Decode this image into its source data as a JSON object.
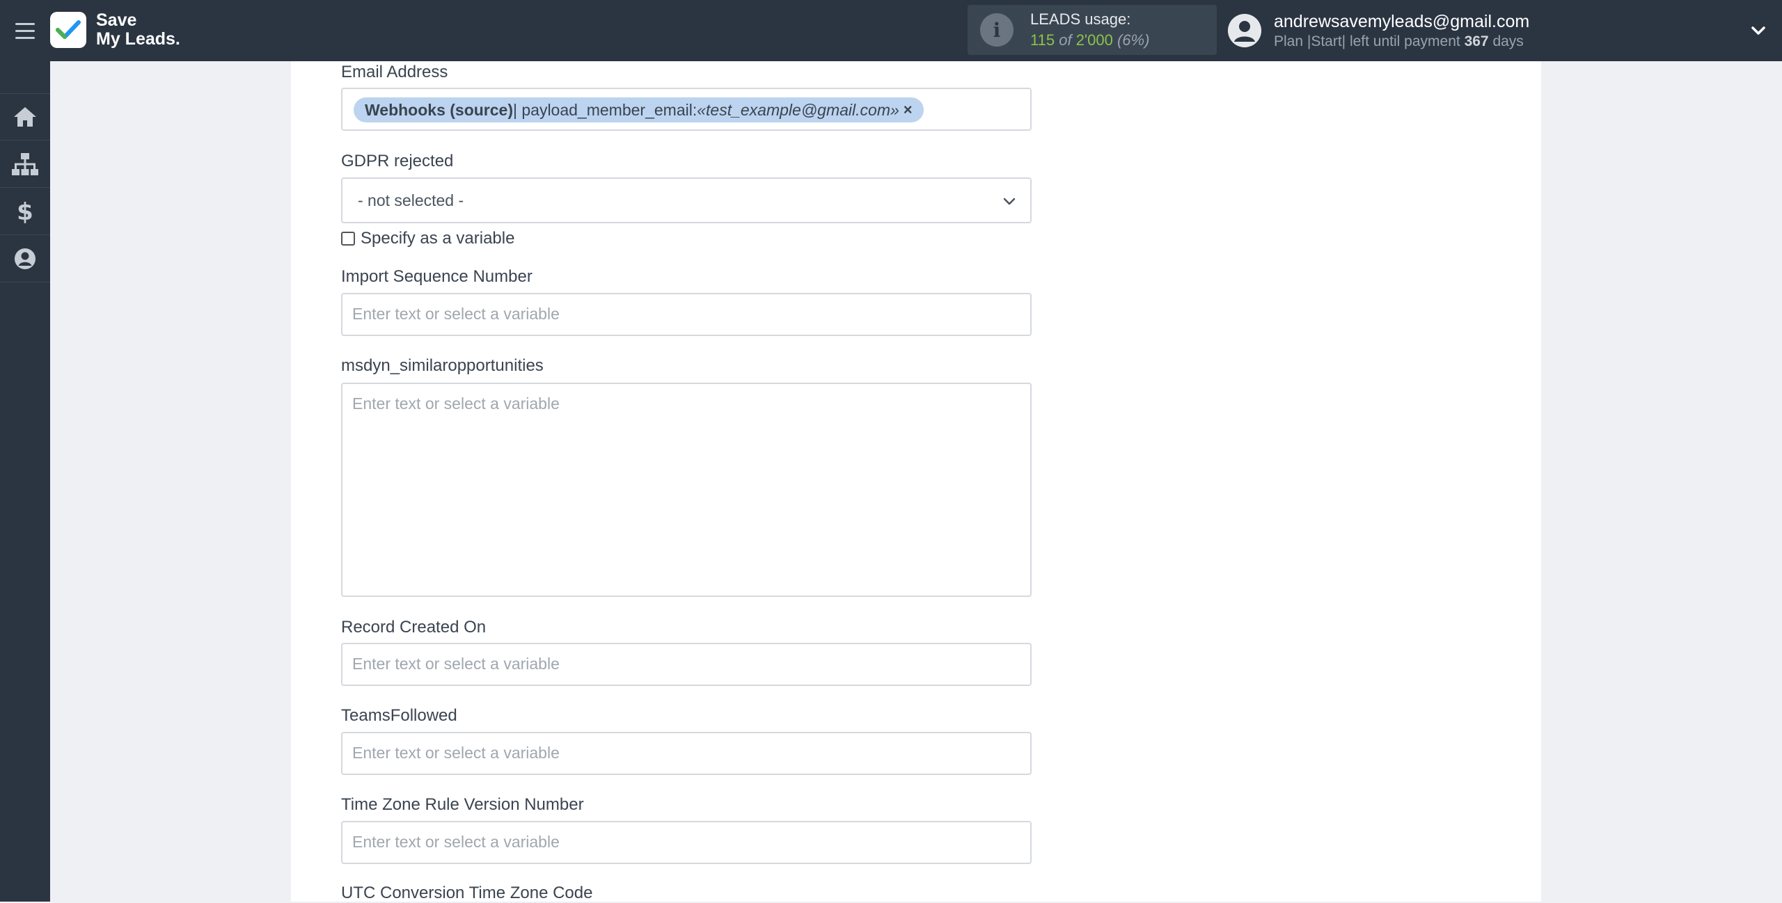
{
  "header": {
    "logo_line1": "Save",
    "logo_line2": "My Leads.",
    "usage_title": "LEADS usage:",
    "usage_used": "115",
    "usage_of": "of",
    "usage_total": "2'000",
    "usage_percent": "(6%)",
    "user_email": "andrewsavemyleads@gmail.com",
    "plan_prefix": "Plan |Start| left until payment",
    "plan_days": "367",
    "plan_suffix": "days",
    "icons": {
      "menu": "hamburger-menu-icon",
      "info": "info-icon",
      "user": "user-avatar-icon",
      "dropdown": "chevron-down-icon"
    }
  },
  "sidebar": {
    "items": [
      {
        "name": "home",
        "icon": "home-icon"
      },
      {
        "name": "connections",
        "icon": "sitemap-icon"
      },
      {
        "name": "billing",
        "icon": "dollar-icon"
      },
      {
        "name": "account",
        "icon": "user-circle-icon"
      }
    ]
  },
  "form": {
    "email_label": "Email Address",
    "email_tag_source": "Webhooks (source)",
    "email_tag_sep": " | payload_member_email: ",
    "email_tag_value": "«test_example@gmail.com»",
    "email_tag_remove": "×",
    "gdpr_label": "GDPR rejected",
    "gdpr_value": "- not selected -",
    "specify_variable": "Specify as a variable",
    "import_seq_label": "Import Sequence Number",
    "import_seq_placeholder": "Enter text or select a variable",
    "similar_opps_label": "msdyn_similaropportunities",
    "similar_opps_placeholder": "Enter text or select a variable",
    "record_created_label": "Record Created On",
    "record_created_placeholder": "Enter text or select a variable",
    "teams_label": "TeamsFollowed",
    "teams_placeholder": "Enter text or select a variable",
    "tz_rule_label": "Time Zone Rule Version Number",
    "tz_rule_placeholder": "Enter text or select a variable",
    "utc_label": "UTC Conversion Time Zone Code"
  },
  "colors": {
    "topbar": "#2b3542",
    "accent_green": "#8bc34a",
    "tag_bg": "#bcd4ef",
    "logo_check": "#2196f3"
  }
}
